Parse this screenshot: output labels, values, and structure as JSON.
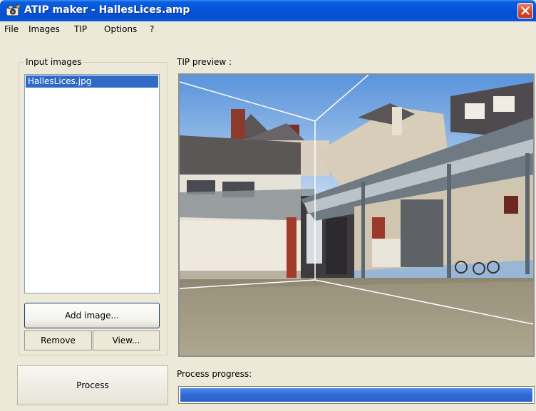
{
  "window": {
    "title": "ATIP maker - HallesLices.amp"
  },
  "menu": {
    "items": [
      "File",
      "Images",
      "TIP",
      "Options",
      "?"
    ]
  },
  "input_images": {
    "group_label": "Input images",
    "files": [
      "HallesLices.jpg"
    ],
    "selected_index": 0,
    "add_label": "Add image...",
    "remove_label": "Remove",
    "view_label": "View..."
  },
  "preview": {
    "label": "TIP preview :"
  },
  "process": {
    "button_label": "Process",
    "progress_label": "Process progress:",
    "progress_fraction": 1.0
  },
  "colors": {
    "titlebar": "#0754d8",
    "selection": "#316ac5",
    "progress_fill": "#2f6bd3",
    "close_button": "#d4472a"
  },
  "icons": {
    "app": "camera-icon",
    "close": "close-icon"
  }
}
